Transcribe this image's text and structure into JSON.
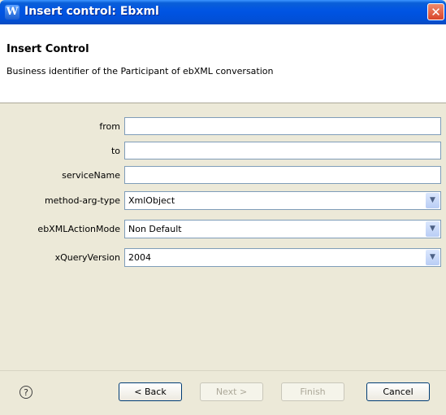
{
  "window": {
    "title": "Insert control: Ebxml",
    "app_icon": "W",
    "close_glyph": "✕"
  },
  "header": {
    "title": "Insert Control",
    "description": "Business identifier of the Participant of ebXML conversation"
  },
  "fields": [
    {
      "label": "from",
      "value": ""
    },
    {
      "label": "to",
      "value": ""
    },
    {
      "label": "serviceName",
      "value": ""
    },
    {
      "label": "method-arg-type",
      "value": "XmlObject"
    },
    {
      "label": "ebXMLActionMode",
      "value": "Non Default"
    },
    {
      "label": "xQueryVersion",
      "value": "2004"
    }
  ],
  "buttons": {
    "back": "< Back",
    "next": "Next >",
    "finish": "Finish",
    "cancel": "Cancel"
  },
  "help_glyph": "?"
}
